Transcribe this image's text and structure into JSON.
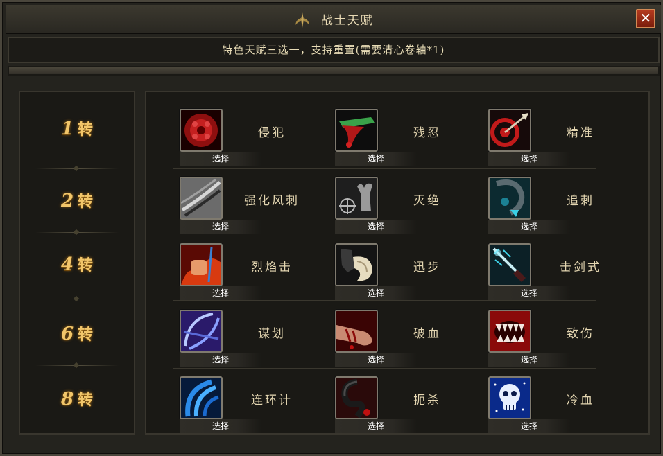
{
  "window": {
    "title": "战士天赋",
    "close_label": "✕",
    "notice": "特色天赋三选一，支持重置(需要清心卷轴*1)"
  },
  "tiers": [
    {
      "num": "1",
      "suffix": "转"
    },
    {
      "num": "2",
      "suffix": "转"
    },
    {
      "num": "4",
      "suffix": "转"
    },
    {
      "num": "6",
      "suffix": "转"
    },
    {
      "num": "8",
      "suffix": "转"
    }
  ],
  "skills": [
    [
      {
        "name": "侵犯",
        "button": "选择",
        "icon": "red-seal-icon"
      },
      {
        "name": "残忍",
        "button": "选择",
        "icon": "bleeding-blade-icon"
      },
      {
        "name": "精准",
        "button": "选择",
        "icon": "target-arrow-icon"
      }
    ],
    [
      {
        "name": "强化风刺",
        "button": "选择",
        "icon": "wind-stab-icon"
      },
      {
        "name": "灭绝",
        "button": "选择",
        "icon": "crosshair-bull-icon"
      },
      {
        "name": "追刺",
        "button": "选择",
        "icon": "hook-blade-icon"
      }
    ],
    [
      {
        "name": "烈焰击",
        "button": "选择",
        "icon": "flame-fist-icon"
      },
      {
        "name": "迅步",
        "button": "选择",
        "icon": "swift-boot-icon"
      },
      {
        "name": "击剑式",
        "button": "选择",
        "icon": "ice-sword-icon"
      }
    ],
    [
      {
        "name": "谋划",
        "button": "选择",
        "icon": "scheme-blades-icon"
      },
      {
        "name": "破血",
        "button": "选择",
        "icon": "bleeding-arm-icon"
      },
      {
        "name": "致伤",
        "button": "选择",
        "icon": "fanged-maw-icon"
      }
    ],
    [
      {
        "name": "连环计",
        "button": "选择",
        "icon": "blue-claw-icon"
      },
      {
        "name": "扼杀",
        "button": "选择",
        "icon": "dark-hook-icon"
      },
      {
        "name": "冷血",
        "button": "选择",
        "icon": "frost-skull-icon"
      }
    ]
  ],
  "colors": {
    "accent_gold": "#f2c66a",
    "close_red": "#b43a1e",
    "text_cream": "#e4d6b1"
  }
}
